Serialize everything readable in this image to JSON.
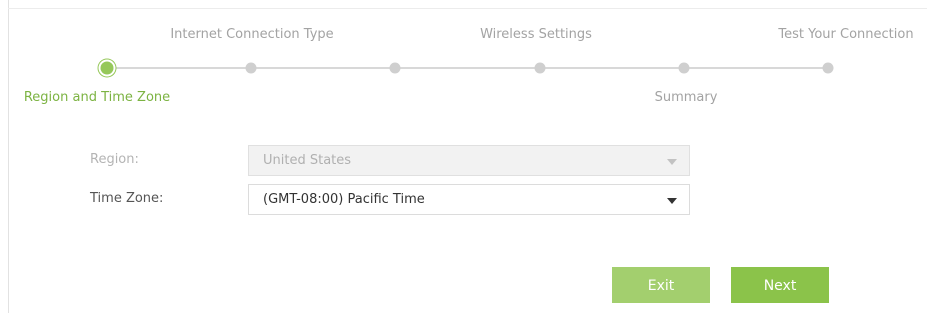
{
  "wizard": {
    "steps": [
      {
        "label": "Region and Time Zone",
        "state": "active"
      },
      {
        "label": "Internet Connection Type",
        "state": "pending"
      },
      {
        "label": "",
        "state": "pending"
      },
      {
        "label": "Wireless Settings",
        "state": "pending"
      },
      {
        "label": "Summary",
        "state": "pending"
      },
      {
        "label": "Test Your Connection",
        "state": "pending"
      }
    ],
    "accent_color": "#8bc34a"
  },
  "form": {
    "region": {
      "label": "Region:",
      "value": "United States",
      "disabled": true
    },
    "time_zone": {
      "label": "Time Zone:",
      "value": "(GMT-08:00) Pacific Time",
      "disabled": false
    }
  },
  "actions": {
    "exit_label": "Exit",
    "next_label": "Next"
  }
}
